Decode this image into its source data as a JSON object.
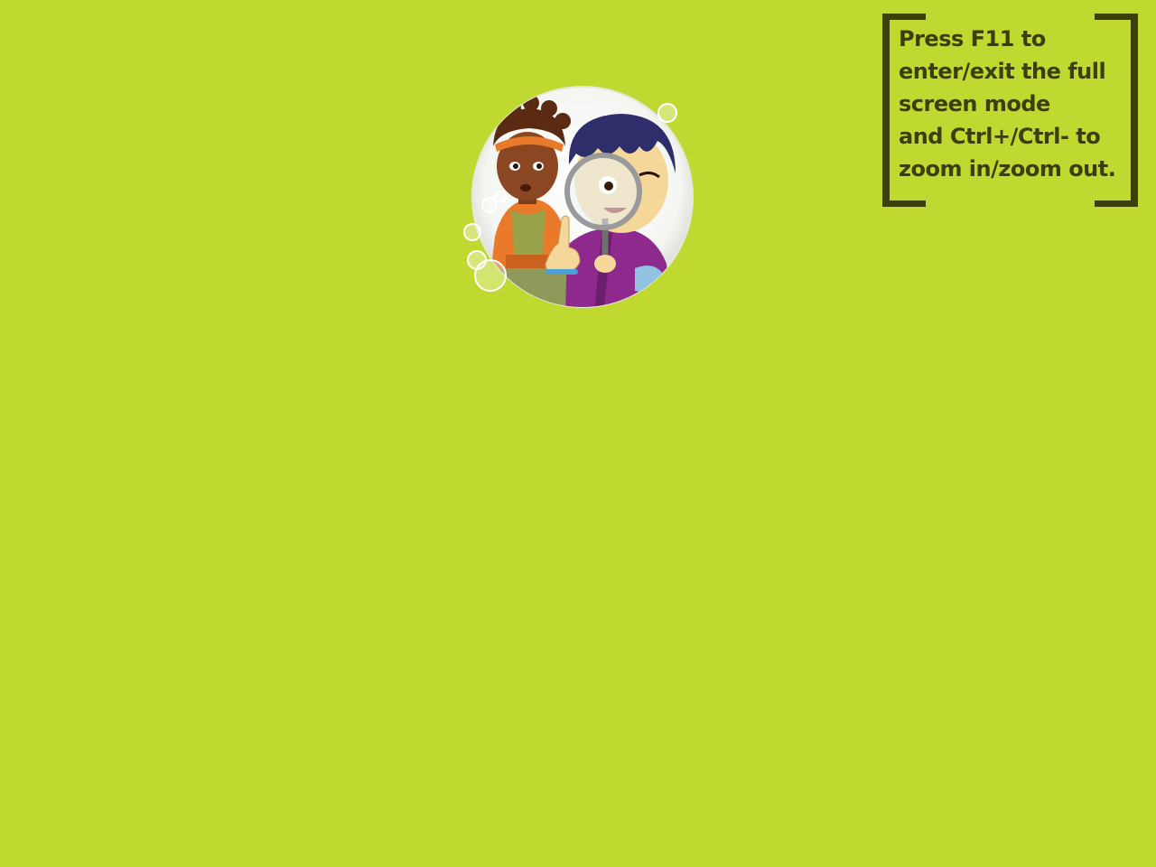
{
  "hint": {
    "lines": [
      "Press F11 to",
      "enter/exit the full",
      "screen mode",
      "and Ctrl+/Ctrl- to",
      "zoom in/zoom out."
    ]
  },
  "colors": {
    "background": "#c0d931",
    "hint_text": "#3c3f0c",
    "bracket": "#3c3f0c"
  },
  "logo": {
    "icon": "detective-kids-logo"
  }
}
